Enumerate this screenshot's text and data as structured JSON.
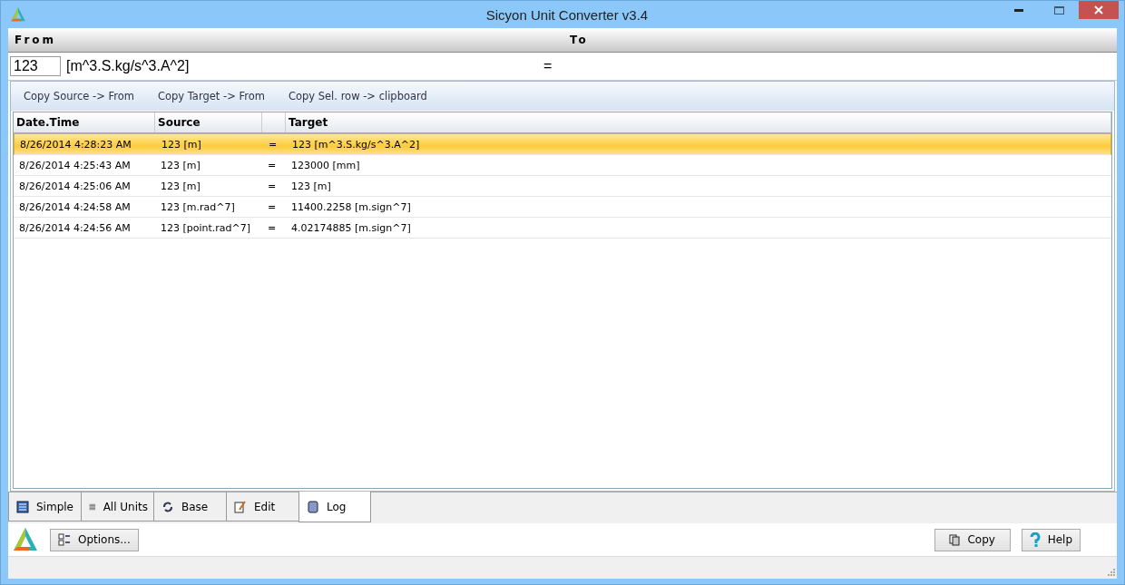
{
  "window": {
    "title": "Sicyon Unit Converter v3.4"
  },
  "header": {
    "from_label": "From",
    "to_label": "To"
  },
  "input": {
    "value": "123",
    "unit": "[m^3.S.kg/s^3.A^2]",
    "equals": "="
  },
  "toolbar": [
    "Copy Source -> From",
    "Copy Target -> From",
    "Copy Sel. row -> clipboard"
  ],
  "table": {
    "columns": [
      "Date.Time",
      "Source",
      "",
      "Target"
    ],
    "rows": [
      {
        "datetime": "8/26/2014 4:28:23 AM",
        "source": "123 [m]",
        "eq": "=",
        "target": "123 [m^3.S.kg/s^3.A^2]",
        "selected": true
      },
      {
        "datetime": "8/26/2014 4:25:43 AM",
        "source": "123 [m]",
        "eq": "=",
        "target": "123000 [mm]",
        "selected": false
      },
      {
        "datetime": "8/26/2014 4:25:06 AM",
        "source": "123 [m]",
        "eq": "=",
        "target": "123 [m]",
        "selected": false
      },
      {
        "datetime": "8/26/2014 4:24:58 AM",
        "source": "123 [m.rad^7]",
        "eq": "=",
        "target": "11400.2258 [m.sign^7]",
        "selected": false
      },
      {
        "datetime": "8/26/2014 4:24:56 AM",
        "source": "123 [point.rad^7]",
        "eq": "=",
        "target": "4.02174885 [m.sign^7]",
        "selected": false
      }
    ]
  },
  "tabs": [
    {
      "label": "Simple",
      "kind": "list",
      "selected": false
    },
    {
      "label": "All Units",
      "kind": "lines",
      "selected": false
    },
    {
      "label": "Base",
      "kind": "cycle",
      "selected": false
    },
    {
      "label": "Edit",
      "kind": "edit",
      "selected": false
    },
    {
      "label": "Log",
      "kind": "log",
      "selected": true
    }
  ],
  "buttons": {
    "options": "Options...",
    "copy": "Copy",
    "help": "Help"
  }
}
